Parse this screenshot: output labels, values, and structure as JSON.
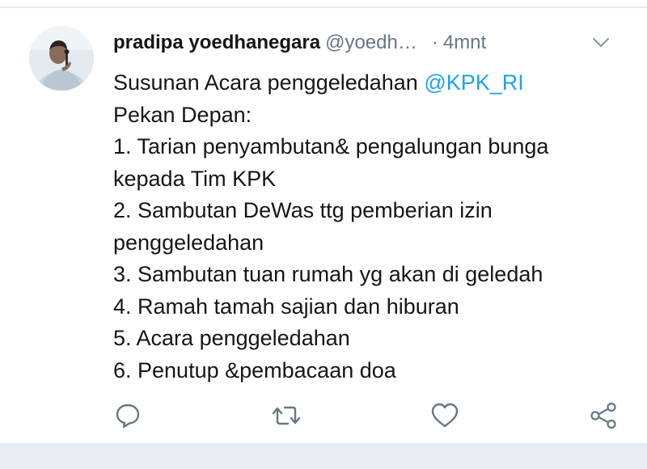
{
  "tweet": {
    "display_name": "pradipa yoedhanegara",
    "handle": "@yoedh…",
    "separator": "·",
    "time": "4mnt",
    "text_line_1_prefix": "Susunan Acara penggeledahan ",
    "mention": "@KPK_RI",
    "lines": [
      "Pekan Depan:",
      "1. Tarian penyambutan& pengalungan bunga",
      "kepada Tim KPK",
      "2. Sambutan DeWas ttg pemberian izin",
      "penggeledahan",
      "3. Sambutan tuan rumah yg akan di geledah",
      "4. Ramah tamah sajian dan hiburan",
      "5. Acara penggeledahan",
      "6. Penutup &pembacaan doa"
    ]
  },
  "actions": {
    "reply_icon": "reply-icon",
    "retweet_icon": "retweet-icon",
    "like_icon": "heart-icon",
    "share_icon": "share-icon"
  },
  "colors": {
    "text": "#14171a",
    "secondary": "#657786",
    "link": "#1da1f2",
    "divider": "#e6ecf0"
  }
}
